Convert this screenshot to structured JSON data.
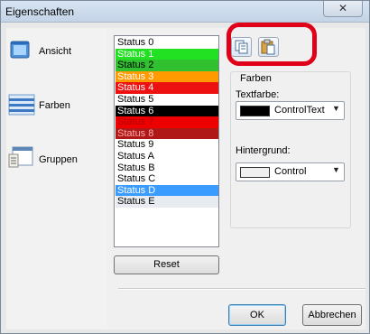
{
  "window": {
    "title": "Eigenschaften",
    "close_glyph": "✕"
  },
  "nav": {
    "items": [
      {
        "label": "Ansicht",
        "icon": "view-window-icon"
      },
      {
        "label": "Farben",
        "icon": "color-stripes-icon"
      },
      {
        "label": "Gruppen",
        "icon": "groups-window-icon"
      }
    ]
  },
  "status_list": {
    "items": [
      {
        "label": "Status 0",
        "bg": "#ffffff",
        "fg": "#000000"
      },
      {
        "label": "Status 1",
        "bg": "#22e022",
        "fg": "#ffffff"
      },
      {
        "label": "Status 2",
        "bg": "#30c030",
        "fg": "#000000"
      },
      {
        "label": "Status 3",
        "bg": "#ff9a00",
        "fg": "#ffffff"
      },
      {
        "label": "Status 4",
        "bg": "#ee1111",
        "fg": "#ffffff"
      },
      {
        "label": "Status 5",
        "bg": "#ffffff",
        "fg": "#000000"
      },
      {
        "label": "Status 6",
        "bg": "#000000",
        "fg": "#ffffff"
      },
      {
        "label": "Status 7",
        "bg": "#ee0000",
        "fg": "#b00000"
      },
      {
        "label": "Status 8",
        "bg": "#b01818",
        "fg": "#ffaaaa"
      },
      {
        "label": "Status 9",
        "bg": "#ffffff",
        "fg": "#000000"
      },
      {
        "label": "Status A",
        "bg": "#ffffff",
        "fg": "#000000"
      },
      {
        "label": "Status B",
        "bg": "#ffffff",
        "fg": "#000000"
      },
      {
        "label": "Status C",
        "bg": "#ffffff",
        "fg": "#000000"
      },
      {
        "label": "Status D",
        "bg": "#3b9cff",
        "fg": "#ffffff"
      },
      {
        "label": "Status E",
        "bg": "#e8ecf0",
        "fg": "#000000"
      }
    ]
  },
  "reset_label": "Reset",
  "toolbar": {
    "copy_icon": "copy-icon",
    "paste_icon": "paste-icon"
  },
  "colors_group": {
    "title": "Farben",
    "text_color": {
      "label": "Textfarbe:",
      "value": "ControlText",
      "swatch": "#000000"
    },
    "background": {
      "label": "Hintergrund:",
      "value": "Control",
      "swatch": "#f0f0f0"
    }
  },
  "buttons": {
    "ok": "OK",
    "cancel": "Abbrechen"
  },
  "annotation": {
    "color": "#e1001a"
  }
}
